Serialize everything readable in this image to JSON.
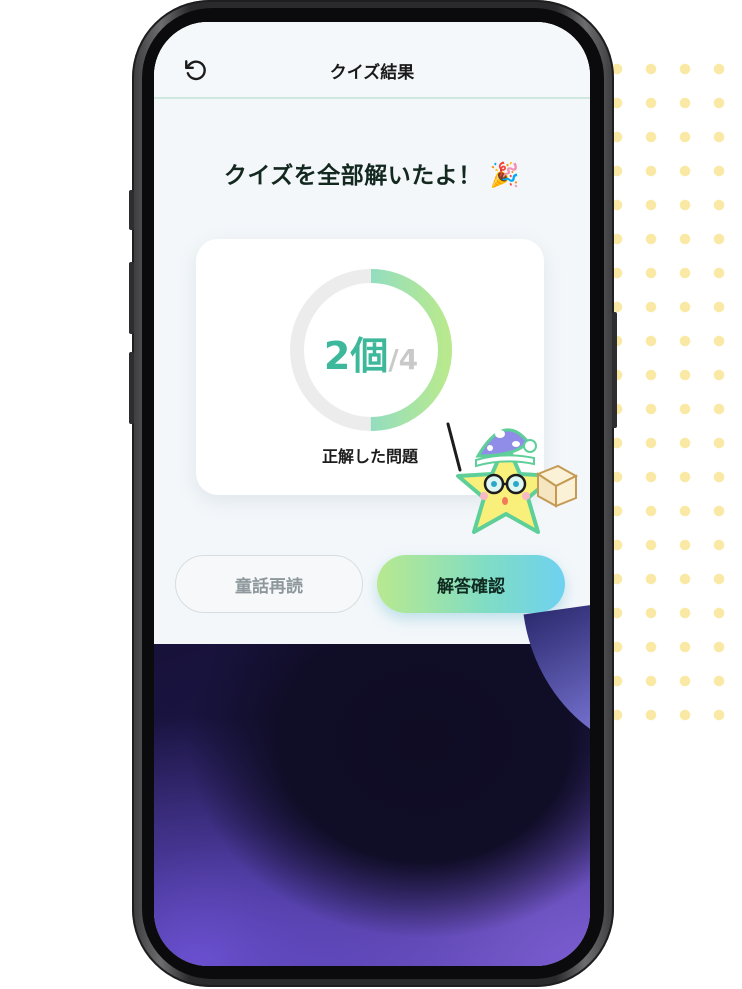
{
  "header": {
    "back_icon": "rotate-ccw-icon",
    "title": "クイズ結果"
  },
  "result": {
    "headline": "クイズを全部解いたよ！",
    "headline_emoji": "🎉",
    "correct_count": "2個",
    "total": "/4",
    "progress": 0.5,
    "label": "正解した問題"
  },
  "buttons": {
    "reread_label": "童話再読",
    "answer_label": "解答確認"
  },
  "colors": {
    "accent_green": "#3db89a",
    "ring_start": "#6ed1f0",
    "ring_end": "#b8e98f",
    "ring_track": "#ececec"
  },
  "mascot_icon": "star-wizard-mascot-icon"
}
